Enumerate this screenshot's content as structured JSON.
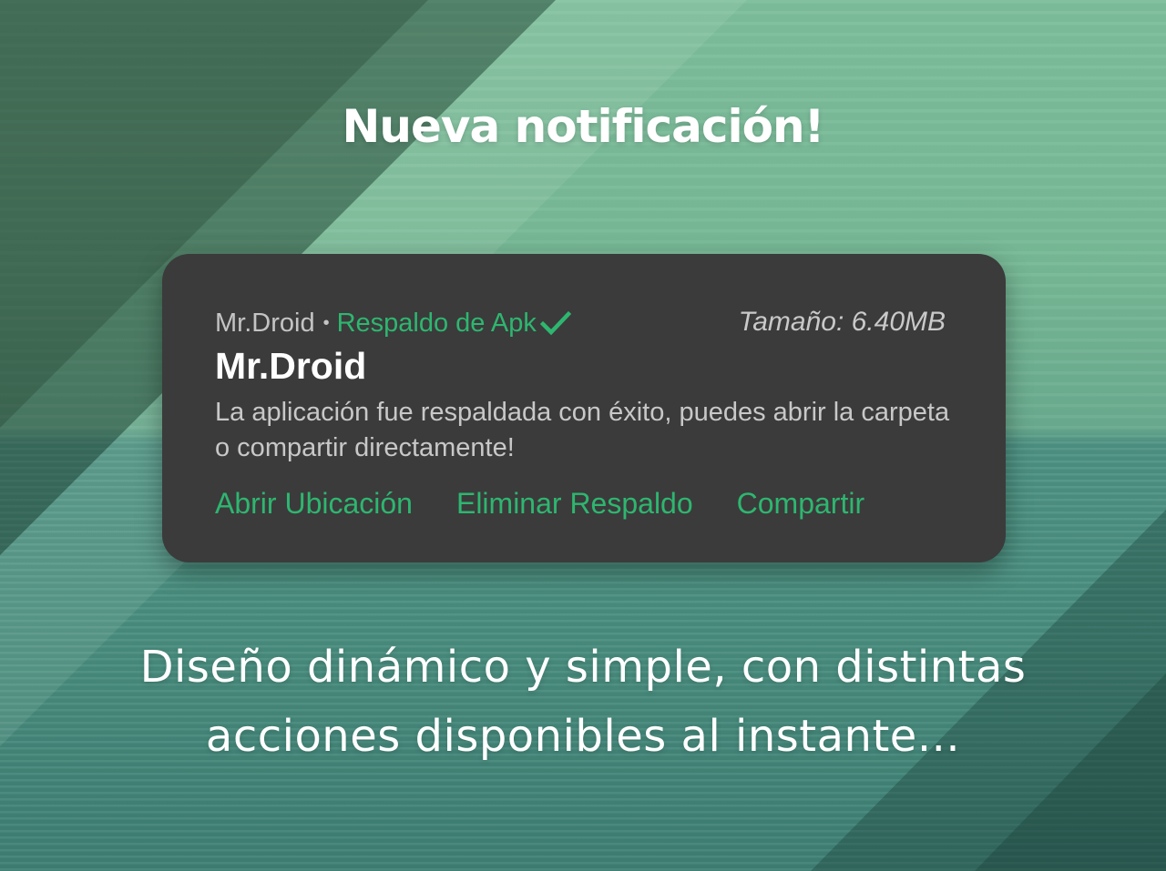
{
  "headline": "Nueva notificación!",
  "notification": {
    "app_name": "Mr.Droid",
    "separator": "•",
    "channel": "Respaldo de Apk",
    "channel_icon": "check-icon",
    "size": "Tamaño: 6.40MB",
    "title": "Mr.Droid",
    "body": "La aplicación fue respaldada con éxito, puedes abrir la carpeta o compartir directamente!",
    "actions": [
      {
        "label": "Abrir Ubicación"
      },
      {
        "label": "Eliminar Respaldo"
      },
      {
        "label": "Compartir"
      }
    ]
  },
  "caption": {
    "line1": "Diseño dinámico y simple, con distintas",
    "line2": "acciones disponibles al instante..."
  },
  "colors": {
    "accent": "#2eb670",
    "card_background": "#3b3b3b",
    "background_green": "#7dbe9c",
    "background_sea": "#4a8f80"
  }
}
